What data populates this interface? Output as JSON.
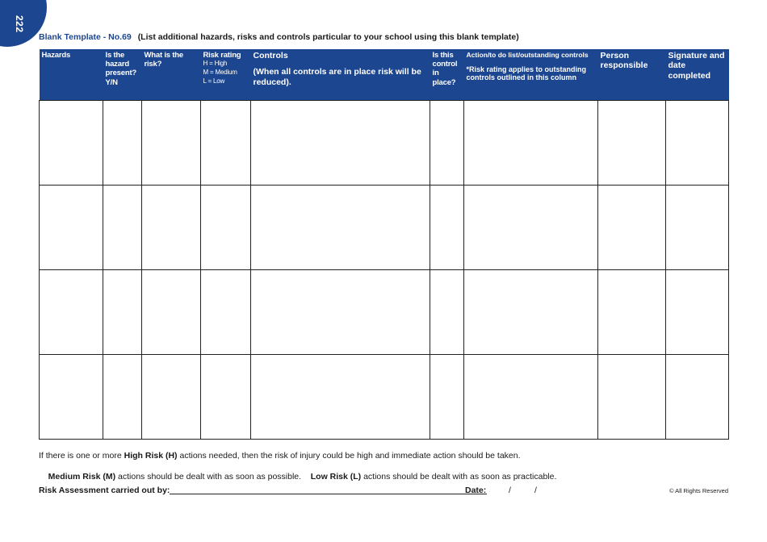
{
  "page": {
    "number": "222",
    "accent_color": "#1d4690"
  },
  "title": {
    "template": "Blank Template - No.69",
    "description": "(List additional hazards, risks and controls particular to your school using this blank template)"
  },
  "table": {
    "headers": {
      "hazards": "Hazards",
      "present": "Is the hazard present? Y/N",
      "risk": "What is the risk?",
      "rating_title": "Risk rating",
      "rating_h": "H = High",
      "rating_m": "M = Medium",
      "rating_l": "L = Low",
      "controls_title": "Controls",
      "controls_note": "(When all controls are in place risk will be reduced).",
      "in_place": "Is this control in place?",
      "action_title": "Action/to do list/outstanding controls",
      "action_note": "*Risk rating applies to outstanding controls outlined in this column",
      "person": "Person responsible",
      "signature": "Signature and date completed"
    },
    "rows": [
      [
        "",
        "",
        "",
        "",
        "",
        "",
        "",
        "",
        ""
      ],
      [
        "",
        "",
        "",
        "",
        "",
        "",
        "",
        "",
        ""
      ],
      [
        "",
        "",
        "",
        "",
        "",
        "",
        "",
        "",
        ""
      ],
      [
        "",
        "",
        "",
        "",
        "",
        "",
        "",
        "",
        ""
      ]
    ]
  },
  "notes": {
    "line1_pre": "If there is one or more ",
    "line1_bold": "High Risk (H)",
    "line1_post": " actions needed, then the risk of injury could be high and immediate action should be taken.",
    "line2_bold1": "Medium Risk (M)",
    "line2_mid": " actions should be dealt with as soon as possible.    ",
    "line2_bold2": "Low Risk (L)",
    "line2_post": " actions should be dealt with as soon as practicable."
  },
  "footer": {
    "carried_out_label": "Risk Assessment carried out by:",
    "carried_out_value": "",
    "date_label": "Date:",
    "date_sep1": "/",
    "date_sep2": "/",
    "copyright": "© All Rights Reserved"
  }
}
